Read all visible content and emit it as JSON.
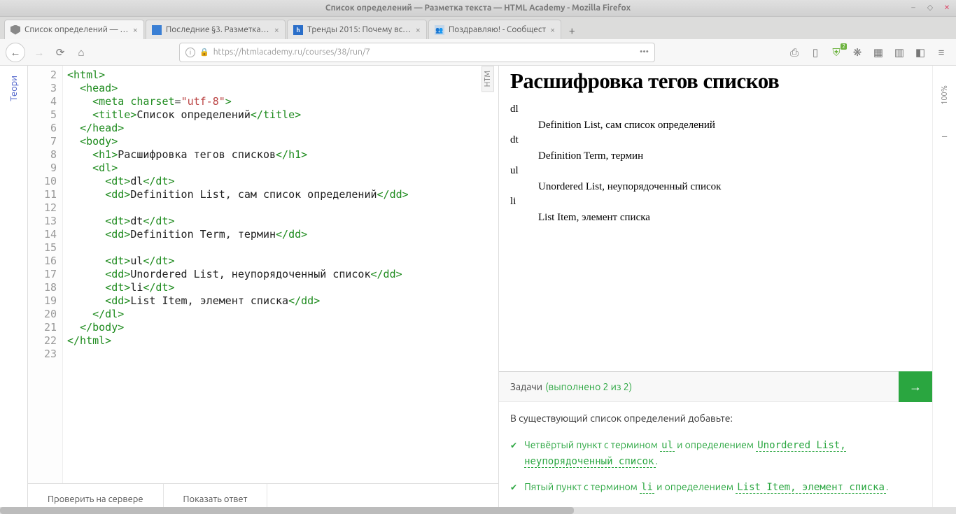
{
  "window_title": "Список определений — Разметка текста — HTML Academy - Mozilla Firefox",
  "tabs": [
    {
      "title": "Список определений — Раз",
      "icon": "shield"
    },
    {
      "title": "Последние §3. Разметка те",
      "icon": "blue"
    },
    {
      "title": "Тренды 2015: Почему всё б",
      "icon": "ha"
    },
    {
      "title": "Поздравляю! - Сообщест",
      "icon": "grp"
    }
  ],
  "url": "https://htmlacademy.ru/courses/38/run/7",
  "theory_label": "Теори",
  "editor_tab_label": "HTM",
  "zoom": "100%",
  "buttons": {
    "check": "Проверить на сервере",
    "answer": "Показать ответ"
  },
  "code_lines": [
    2,
    3,
    4,
    5,
    6,
    7,
    8,
    9,
    10,
    11,
    12,
    13,
    14,
    15,
    16,
    17,
    18,
    19,
    20,
    21,
    22,
    23
  ],
  "preview": {
    "heading": "Расшифровка тегов списков",
    "items": [
      {
        "dt": "dl",
        "dd": "Definition List, сам список определений"
      },
      {
        "dt": "dt",
        "dd": "Definition Term, термин"
      },
      {
        "dt": "ul",
        "dd": "Unordered List, неупорядоченный список"
      },
      {
        "dt": "li",
        "dd": "List Item, элемент списка"
      }
    ]
  },
  "tasks": {
    "label": "Задачи",
    "done": "(выполнено 2 из 2)",
    "intro": "В существующий список определений добавьте:",
    "items": [
      {
        "pre": "Четвёртый пункт с термином ",
        "t1": "ul",
        "mid": " и определением ",
        "t2": "Unordered List, неупорядоченный список",
        "post": "."
      },
      {
        "pre": "Пятый пункт с термином ",
        "t1": "li",
        "mid": " и определением ",
        "t2": "List Item, элемент списка",
        "post": "."
      }
    ]
  }
}
